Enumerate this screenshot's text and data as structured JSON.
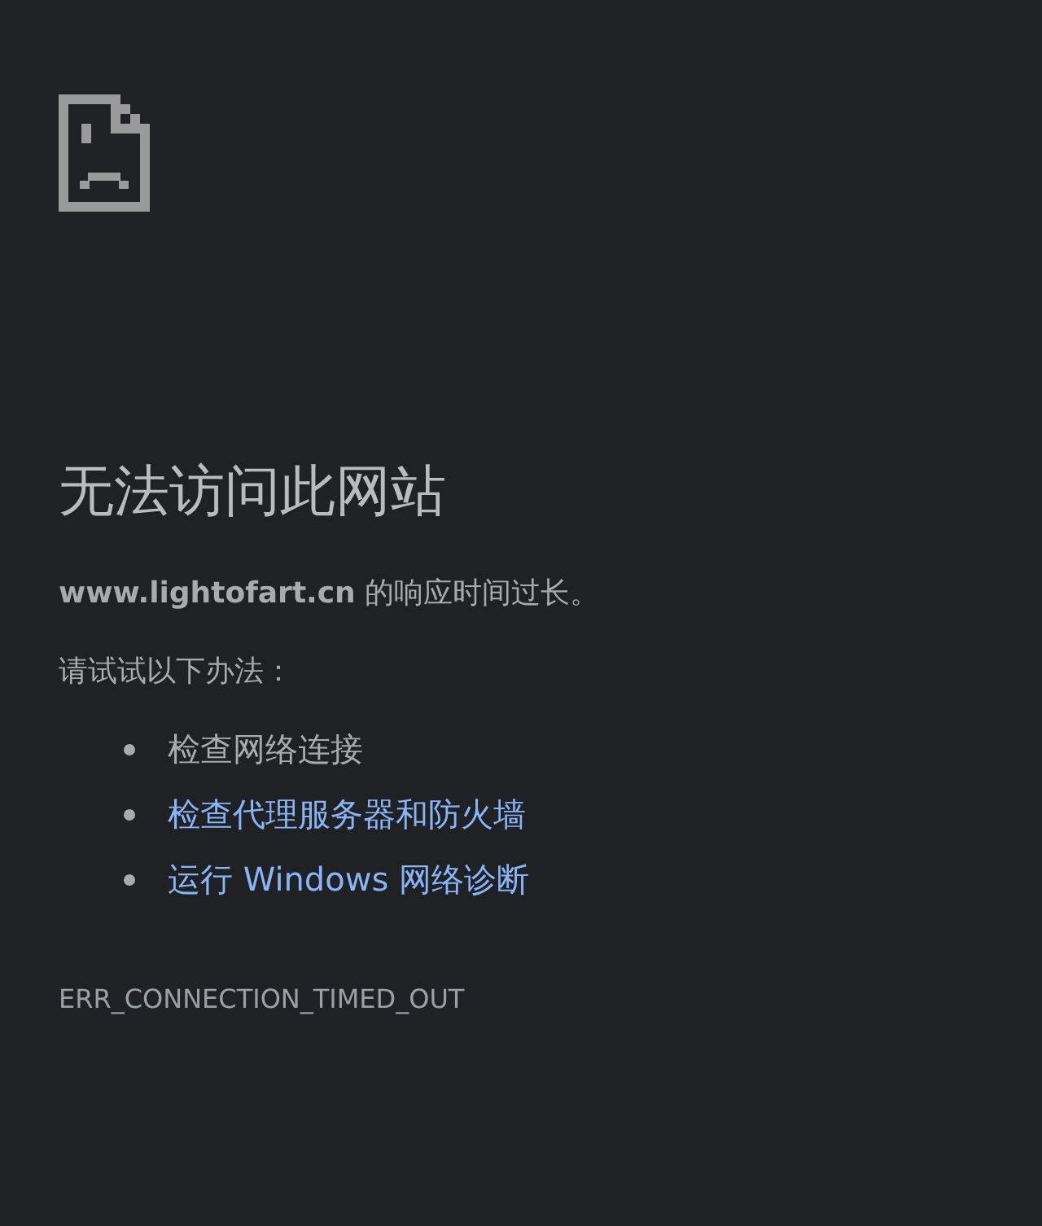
{
  "title": "无法访问此网站",
  "message": "**www.lightofart.cn** 的响应时间过长。",
  "suggestions_heading": "请试试以下办法：",
  "suggestions": [
    {
      "kind": "text",
      "label": "检查网络连接"
    },
    {
      "kind": "link",
      "label": "检查代理服务器和防火墙"
    },
    {
      "kind": "link",
      "label": "运行 Windows 网络诊断"
    }
  ],
  "error_code": "ERR_CONNECTION_TIMED_OUT"
}
